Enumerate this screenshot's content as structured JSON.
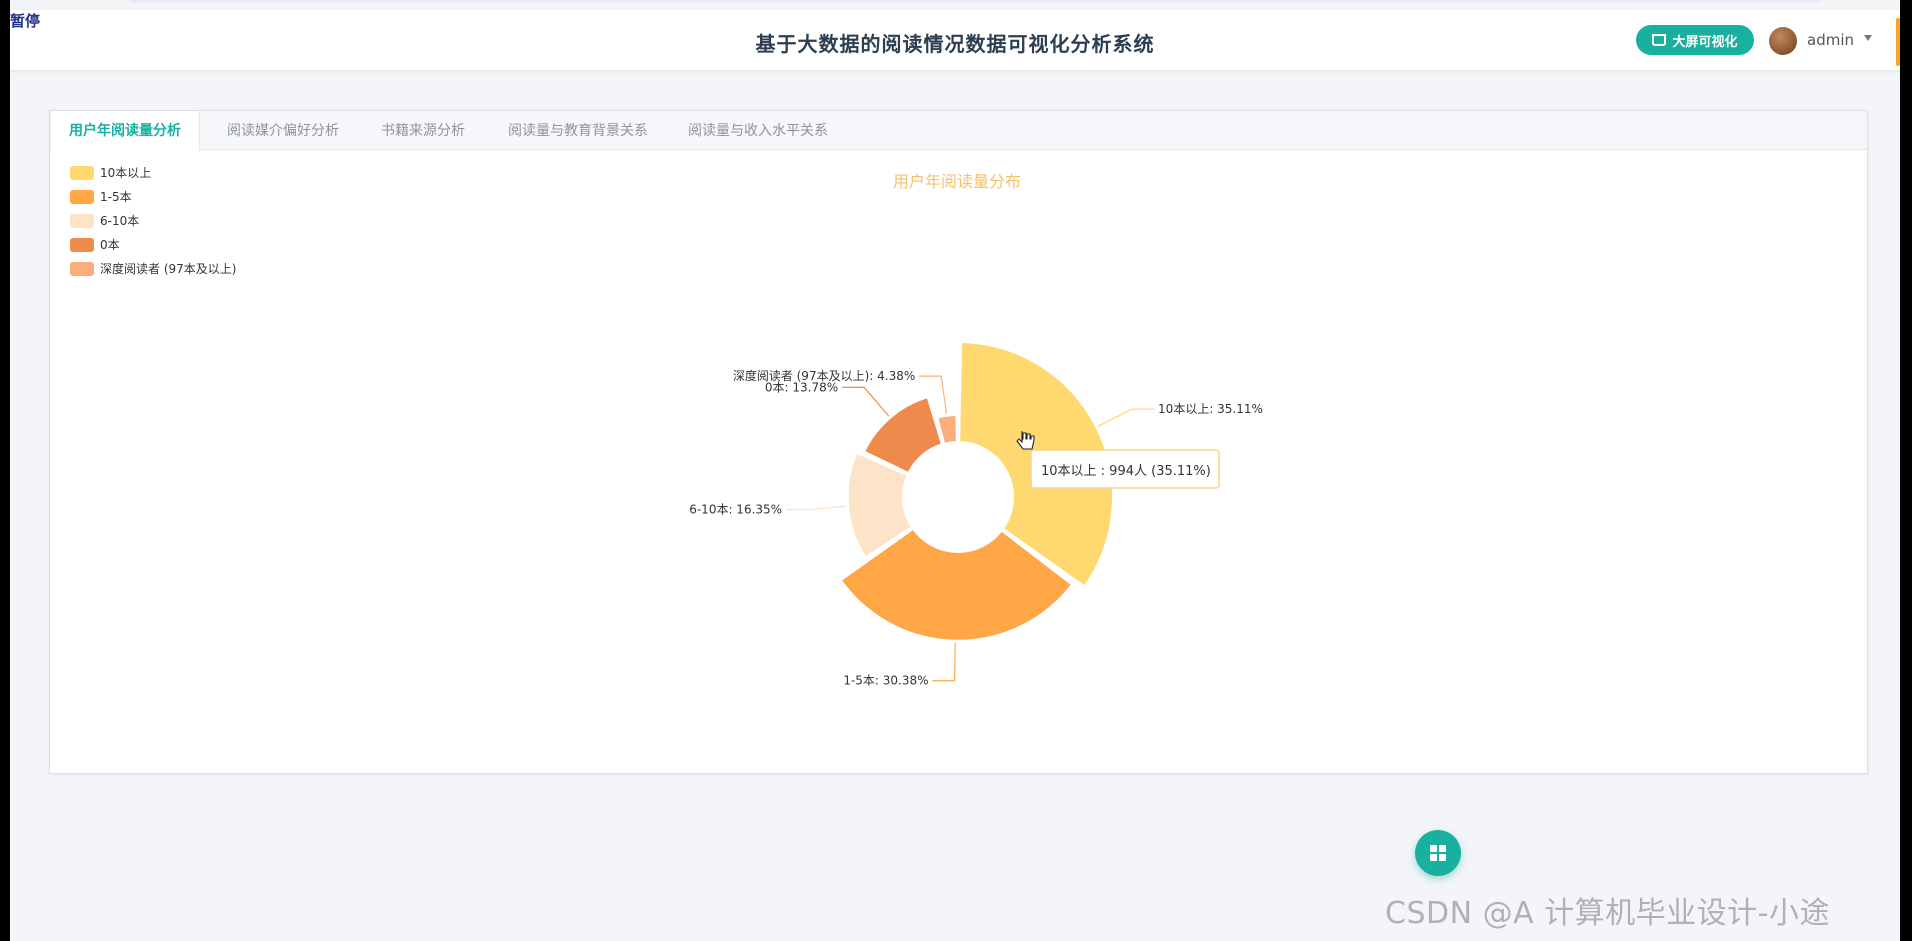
{
  "overlay": {
    "pause_label": "暂停"
  },
  "header": {
    "title": "基于大数据的阅读情况数据可视化分析系统",
    "bigscreen_label": "大屏可视化",
    "user_name": "admin"
  },
  "tabs": [
    {
      "label": "用户年阅读量分析",
      "active": true
    },
    {
      "label": "阅读媒介偏好分析",
      "active": false
    },
    {
      "label": "书籍来源分析",
      "active": false
    },
    {
      "label": "阅读量与教育背景关系",
      "active": false
    },
    {
      "label": "阅读量与收入水平关系",
      "active": false
    }
  ],
  "chart_data": {
    "type": "pie",
    "subtype": "rose",
    "title": "用户年阅读量分布",
    "title_color": "#f5c26b",
    "legend_position": "top-left",
    "slices": [
      {
        "name": "10本以上",
        "value": 994,
        "percent": 35.11,
        "color": "#ffd970",
        "label": "10本以上: 35.11%"
      },
      {
        "name": "1-5本",
        "value": 860,
        "percent": 30.38,
        "color": "#ffa646",
        "label": "1-5本: 30.38%"
      },
      {
        "name": "6-10本",
        "value": 463,
        "percent": 16.35,
        "color": "#fde3c8",
        "label": "6-10本: 16.35%"
      },
      {
        "name": "0本",
        "value": 390,
        "percent": 13.78,
        "color": "#ee8b4c",
        "label": "0本: 13.78%"
      },
      {
        "name": "深度阅读者 (97本及以上)",
        "value": 124,
        "percent": 4.38,
        "color": "#fbae7c",
        "label": "深度阅读者 (97本及以上): 4.38%"
      }
    ],
    "tooltip": {
      "text": "10本以上 : 994人 (35.11%)"
    }
  },
  "fab": {
    "icon": "grid-icon"
  },
  "watermark": {
    "text": "CSDN @A 计算机毕业设计-小途"
  }
}
